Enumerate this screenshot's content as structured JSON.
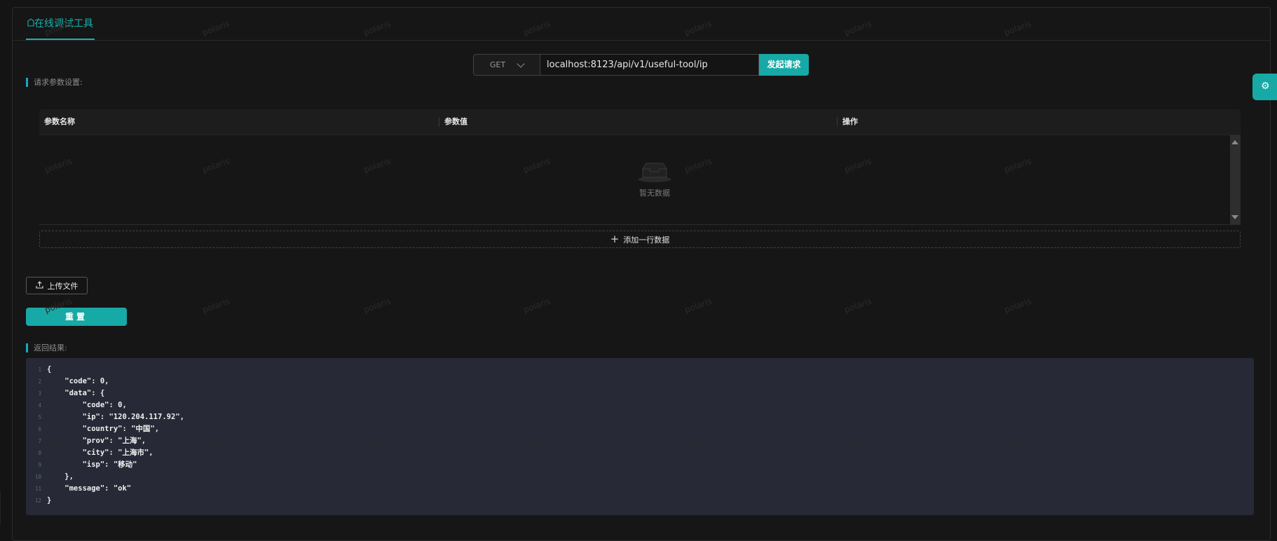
{
  "tab": {
    "label": "在线调试工具"
  },
  "request": {
    "method": "GET",
    "url": "localhost:8123/api/v1/useful-tool/ip",
    "send_label": "发起请求"
  },
  "params_section": {
    "label": "请求参数设置:"
  },
  "table": {
    "columns": [
      "参数名称",
      "参数值",
      "操作"
    ],
    "empty_text": "暂无数据"
  },
  "add_row_label": "添加一行数据",
  "upload_label": "上传文件",
  "reset_label": "重置",
  "result_section": {
    "label": "返回结果:"
  },
  "code_lines": [
    {
      "no": "1",
      "text": "{"
    },
    {
      "no": "2",
      "text": "    \"code\": 0,"
    },
    {
      "no": "3",
      "text": "    \"data\": {"
    },
    {
      "no": "4",
      "text": "        \"code\": 0,"
    },
    {
      "no": "5",
      "text": "        \"ip\": \"120.204.117.92\","
    },
    {
      "no": "6",
      "text": "        \"country\": \"中国\","
    },
    {
      "no": "7",
      "text": "        \"prov\": \"上海\","
    },
    {
      "no": "8",
      "text": "        \"city\": \"上海市\","
    },
    {
      "no": "9",
      "text": "        \"isp\": \"移动\""
    },
    {
      "no": "10",
      "text": "    },"
    },
    {
      "no": "11",
      "text": "    \"message\": \"ok\""
    },
    {
      "no": "12",
      "text": "}"
    }
  ],
  "watermark": "polaris",
  "colors": {
    "accent": "#17a9a6",
    "background": "#141414",
    "code_bg": "#272a36"
  },
  "icons": {
    "tab": "tool-icon",
    "empty": "inbox-icon",
    "add": "plus-icon",
    "upload": "upload-icon",
    "side": "gear-icon"
  }
}
